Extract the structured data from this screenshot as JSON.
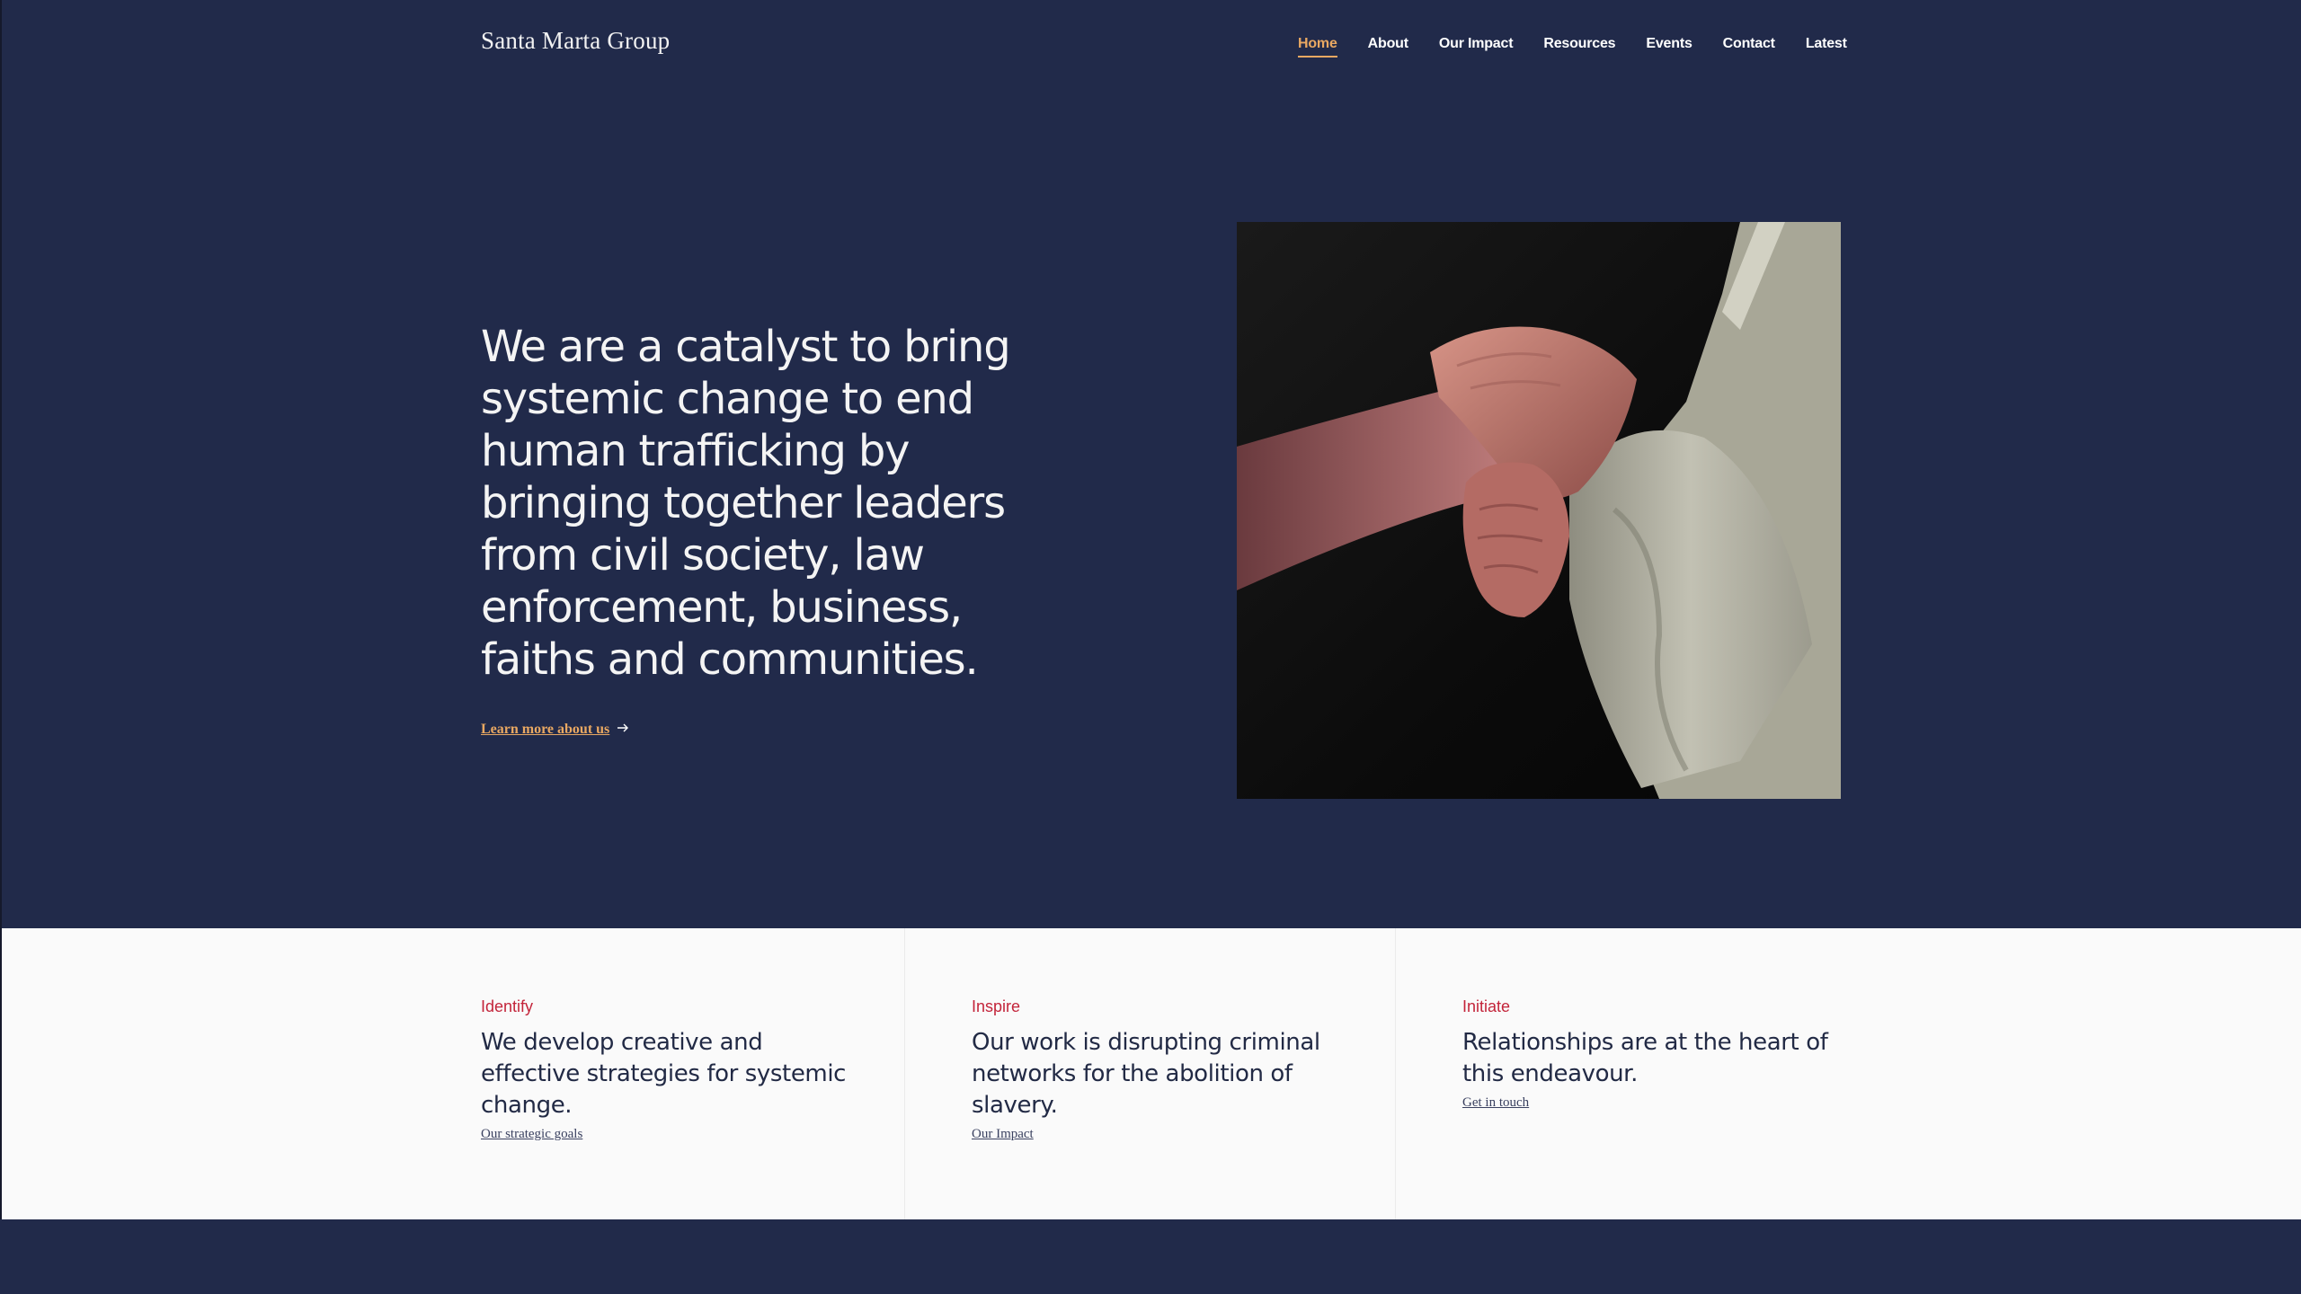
{
  "header": {
    "logo": "Santa Marta Group",
    "nav": [
      {
        "label": "Home",
        "active": true
      },
      {
        "label": "About"
      },
      {
        "label": "Our Impact"
      },
      {
        "label": "Resources"
      },
      {
        "label": "Events"
      },
      {
        "label": "Contact"
      },
      {
        "label": "Latest"
      }
    ]
  },
  "hero": {
    "headline": "We are a catalyst to bring systemic change to end human trafficking by bringing together leaders from civil society, law enforcement, business, faiths and communities.",
    "link_label": "Learn more about us",
    "link_icon": "arrow-right-icon",
    "image_subject": "clasped-hands"
  },
  "pillars": [
    {
      "label": "Identify",
      "text": "We develop creative and effective strategies for systemic change.",
      "link": "Our strategic goals"
    },
    {
      "label": "Inspire",
      "text": "Our work is disrupting criminal networks for the abolition of slavery.",
      "link": "Our Impact"
    },
    {
      "label": "Initiate",
      "text": "Relationships are at the heart of this endeavour.",
      "link": "Get in touch"
    }
  ],
  "colors": {
    "navy": "#212a4a",
    "accent": "#e9a862",
    "red_label": "#c3243a",
    "white_section": "#fafafa"
  }
}
